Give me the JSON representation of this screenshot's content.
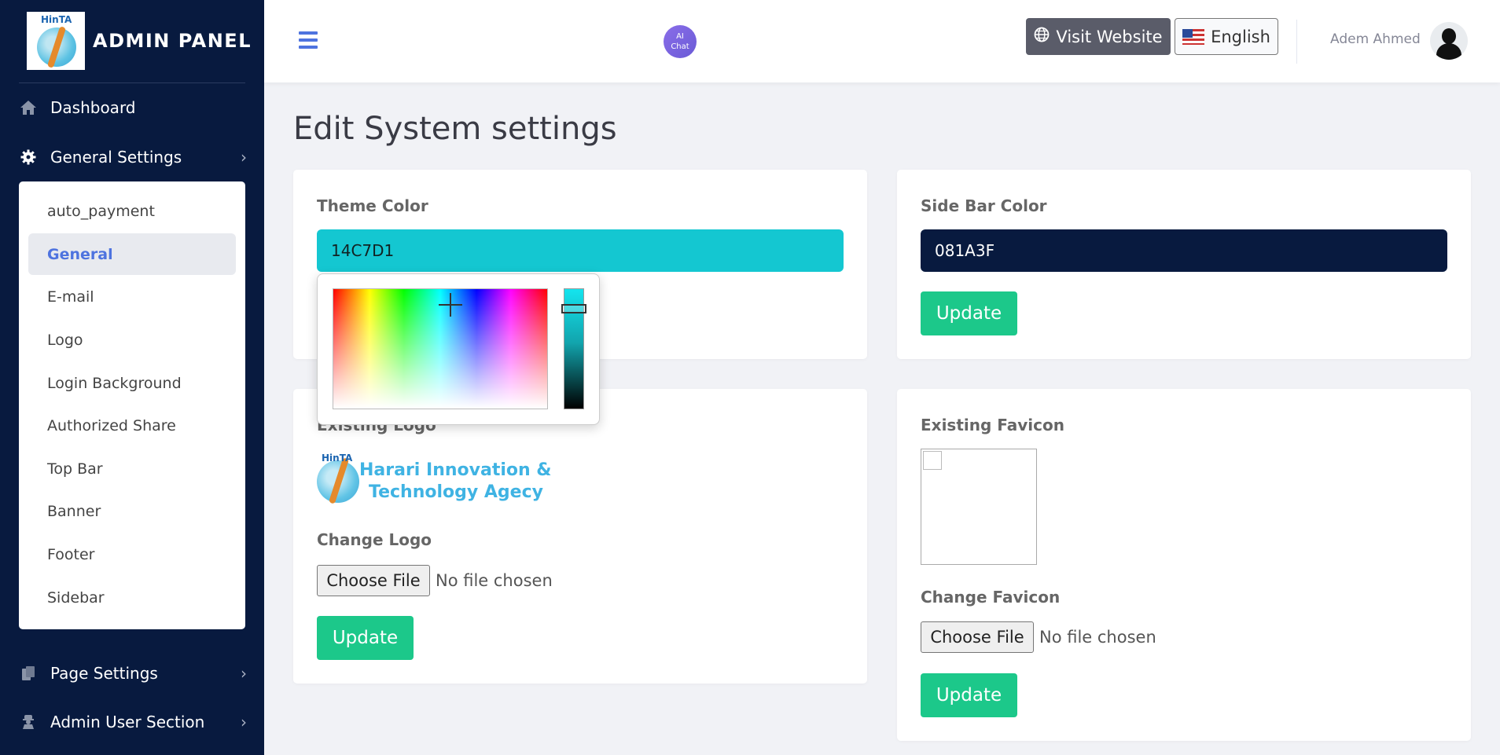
{
  "sidebar": {
    "brand_title": "ADMIN PANEL",
    "brand_logo_text": "HinTA",
    "items": [
      {
        "label": "Dashboard",
        "icon": "home-icon"
      },
      {
        "label": "General Settings",
        "icon": "gear-icon"
      },
      {
        "label": "Page Settings",
        "icon": "copy-icon"
      },
      {
        "label": "Admin User Section",
        "icon": "user-secret-icon"
      }
    ],
    "submenu": [
      {
        "label": "auto_payment"
      },
      {
        "label": "General",
        "active": true
      },
      {
        "label": "E-mail"
      },
      {
        "label": "Logo"
      },
      {
        "label": "Login Background"
      },
      {
        "label": "Authorized Share"
      },
      {
        "label": "Top Bar"
      },
      {
        "label": "Banner"
      },
      {
        "label": "Footer"
      },
      {
        "label": "Sidebar"
      }
    ],
    "colors": {
      "background": "#081A3F",
      "active_text": "#4e73df"
    }
  },
  "topbar": {
    "ai_chat_line1": "AI",
    "ai_chat_line2": "Chat",
    "visit_website": "Visit Website",
    "language": "English",
    "username": "Adem Ahmed"
  },
  "main": {
    "page_title": "Edit System settings",
    "theme_color": {
      "label": "Theme Color",
      "value": "14C7D1",
      "color": "#14C7D1"
    },
    "sidebar_color": {
      "label": "Side Bar Color",
      "value": "081A3F",
      "color": "#081A3F",
      "update": "Update"
    },
    "logo": {
      "existing_label": "Existing Logo",
      "logo_line1": "Harari Innovation &",
      "logo_line2": "Technology Agecy",
      "logo_mark": "HinTA",
      "change_label": "Change Logo",
      "choose_file": "Choose File",
      "no_file": "No file chosen",
      "update": "Update"
    },
    "favicon": {
      "existing_label": "Existing Favicon",
      "change_label": "Change Favicon",
      "choose_file": "Choose File",
      "no_file": "No file chosen",
      "update": "Update"
    },
    "accent_colors": {
      "update_button": "#1cc88a",
      "visit_button": "#5a5c69"
    }
  }
}
